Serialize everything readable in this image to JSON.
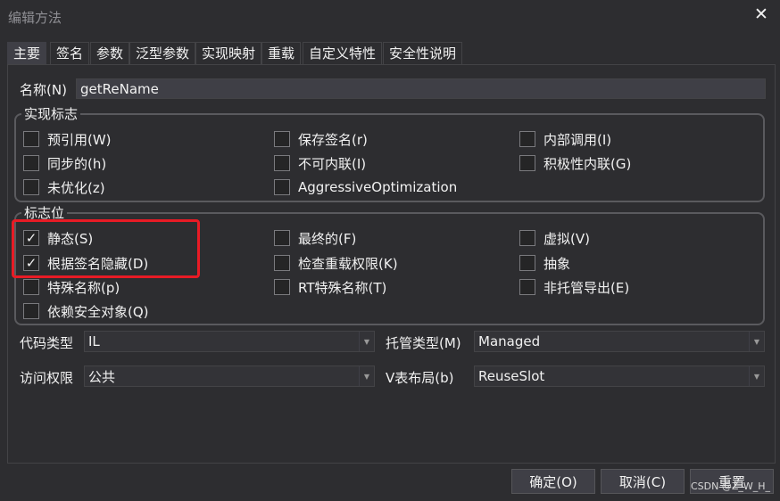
{
  "window": {
    "title": "编辑方法",
    "close_glyph": "✕"
  },
  "tabs": [
    {
      "label": "主要",
      "active": true
    },
    {
      "label": "签名"
    },
    {
      "label": "参数"
    },
    {
      "label": "泛型参数"
    },
    {
      "label": "实现映射"
    },
    {
      "label": "重载"
    },
    {
      "label": "自定义特性"
    },
    {
      "label": "安全性说明"
    }
  ],
  "name_field": {
    "label": "名称(N)",
    "value": "getReName"
  },
  "impl_flags": {
    "title": "实现标志",
    "items": [
      {
        "label": "预引用(W)",
        "checked": false
      },
      {
        "label": "保存签名(r)",
        "checked": false
      },
      {
        "label": "内部调用(I)",
        "checked": false
      },
      {
        "label": "同步的(h)",
        "checked": false
      },
      {
        "label": "不可内联(I)",
        "checked": false
      },
      {
        "label": "积极性内联(G)",
        "checked": false
      },
      {
        "label": "未优化(z)",
        "checked": false
      },
      {
        "label": "AggressiveOptimization",
        "checked": false
      }
    ]
  },
  "flags": {
    "title": "标志位",
    "items": [
      {
        "label": "静态(S)",
        "checked": true
      },
      {
        "label": "最终的(F)",
        "checked": false
      },
      {
        "label": "虚拟(V)",
        "checked": false
      },
      {
        "label": "根据签名隐藏(D)",
        "checked": true
      },
      {
        "label": "检查重载权限(K)",
        "checked": false
      },
      {
        "label": "抽象",
        "checked": false
      },
      {
        "label": "特殊名称(p)",
        "checked": false
      },
      {
        "label": "RT特殊名称(T)",
        "checked": false
      },
      {
        "label": "非托管导出(E)",
        "checked": false
      },
      {
        "label": "依赖安全对象(Q)",
        "checked": false
      }
    ]
  },
  "code_type": {
    "label": "代码类型",
    "value": "IL"
  },
  "managed_type": {
    "label": "托管类型(M)",
    "value": "Managed"
  },
  "access": {
    "label": "访问权限",
    "value": "公共"
  },
  "vtable_layout": {
    "label": "V表布局(b)",
    "value": "ReuseSlot"
  },
  "buttons": {
    "ok": "确定(O)",
    "cancel": "取消(C)",
    "reset": "重置"
  },
  "check_glyph": "✓",
  "watermark": "CSDN @Z_W_H_",
  "colors": {
    "highlight": "#e81b25",
    "background": "#2d2d30",
    "field": "#3f3f46"
  }
}
